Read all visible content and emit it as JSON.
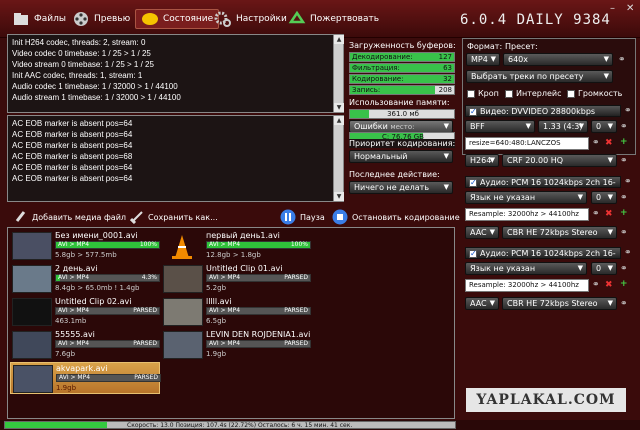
{
  "tabs": [
    {
      "label": "Файлы"
    },
    {
      "label": "Превью"
    },
    {
      "label": "Состояние"
    },
    {
      "label": "Настройки"
    },
    {
      "label": "Пожертвовать"
    }
  ],
  "version": "6.0.4 DAILY 9384",
  "window_controls": {
    "min": "–",
    "close": "✕"
  },
  "log_top": [
    "Init H264 codec, threads: 2, stream: 0",
    "Video codec 0 timebase: 1 / 25 > 1 / 25",
    "Video stream 0 timebase: 1 / 25 > 1 / 25",
    "Init AAC codec, threads: 1, stream: 1",
    "Audio codec 1 timebase: 1 / 32000 > 1 / 44100",
    "Audio stream 1 timebase: 1 / 32000 > 1 / 44100"
  ],
  "log_bottom": [
    "AC EOB marker is absent pos=64",
    "AC EOB marker is absent pos=64",
    "AC EOB marker is absent pos=64",
    "AC EOB marker is absent pos=68",
    "AC EOB marker is absent pos=64",
    "AC EOB marker is absent pos=64"
  ],
  "buffers": {
    "title": "Загруженность буферов:",
    "rows": [
      {
        "label": "Декодирование:",
        "value": "127",
        "pct": 100
      },
      {
        "label": "Фильтрация:",
        "value": "63",
        "pct": 100
      },
      {
        "label": "Кодирование:",
        "value": "32",
        "pct": 100
      },
      {
        "label": "Запись:",
        "value": "208",
        "pct": 82
      }
    ]
  },
  "memory": {
    "title": "Использование памяти:",
    "used": "361.0 мб",
    "free": "С: 76.76 GB",
    "free_label": "место:",
    "used_pct": 18,
    "free_pct": 70
  },
  "errors_select": "Ошибки",
  "priority": {
    "title": "Приоритет кодирования:",
    "value": "Нормальный"
  },
  "last_action": {
    "title": "Последнее действие:",
    "value": "Ничего не делать"
  },
  "toolbar": {
    "add": "Добавить медиа файл",
    "save": "Сохранить как...",
    "pause": "Пауза",
    "stop": "Остановить кодирование"
  },
  "files": [
    {
      "title": "Без имени_0001.avi",
      "status": "AVI > MP4",
      "right": "100%",
      "progress": 100,
      "size": "5.8gb > 577.5mb"
    },
    {
      "title": "первый день1.avi",
      "status": "AVI > MP4",
      "right": "100%",
      "progress": 100,
      "size": "12.8gb > 1.8gb"
    },
    {
      "title": "2 день.avi",
      "status": "AVI > MP4",
      "right": "4.3%",
      "progress": 4,
      "size": "8.4gb > 65.0mb ! 1.4gb"
    },
    {
      "title": "Untitled Clip 01.avi",
      "status": "AVI > MP4",
      "right": "PARSED",
      "progress": 0,
      "size": "5.2gb"
    },
    {
      "title": "Untitled Clip 02.avi",
      "status": "AVI > MP4",
      "right": "PARSED",
      "progress": 0,
      "size": "463.1mb"
    },
    {
      "title": "lllll.avi",
      "status": "AVI > MP4",
      "right": "PARSED",
      "progress": 0,
      "size": "6.5gb"
    },
    {
      "title": "55555.avi",
      "status": "AVI > MP4",
      "right": "PARSED",
      "progress": 0,
      "size": "7.6gb"
    },
    {
      "title": "LEVIN DEN ROJDENIA1.avi",
      "status": "AVI > MP4",
      "right": "PARSED",
      "progress": 0,
      "size": "1.9gb"
    },
    {
      "title": "akvapark.avi",
      "status": "AVI > MP4",
      "right": "PARSED",
      "progress": 0,
      "size": "1.9gb"
    }
  ],
  "right": {
    "format_label": "Формат:",
    "preset_label": "Пресет:",
    "format": "MP4",
    "preset": "640x",
    "tracks": "Выбрать треки по пресету",
    "crop": "Кроп",
    "interlace": "Интерлейс",
    "volume": "Громкость",
    "video_header": "Видео: DVVIDEO 28800kbps 720x576...",
    "bff": "BFF",
    "aspect": "1.33 (4:3)",
    "zero": "0",
    "resize": "resize=640:480:LANCZOS",
    "vcodec": "H264",
    "crf": "CRF 20.00 HQ",
    "audio1_header": "Аудио: PCM 16 1024kbps 2ch 16-bit...",
    "lang": "Язык не указан",
    "resample": "Resample: 32000hz > 44100hz",
    "acodec": "AAC",
    "cbr": "CBR HE 72kbps Stereo",
    "audio2_header": "Аудио: PCM 16 1024kbps 2ch 16-bit..."
  },
  "statusbar": {
    "text": "Скорость: 13.0 Позиция: 107.4s (22.72%) Осталось: 6 ч. 15 мин. 41 сек.",
    "pct": 22.72
  },
  "watermark": "YAPLAKAL.COM"
}
